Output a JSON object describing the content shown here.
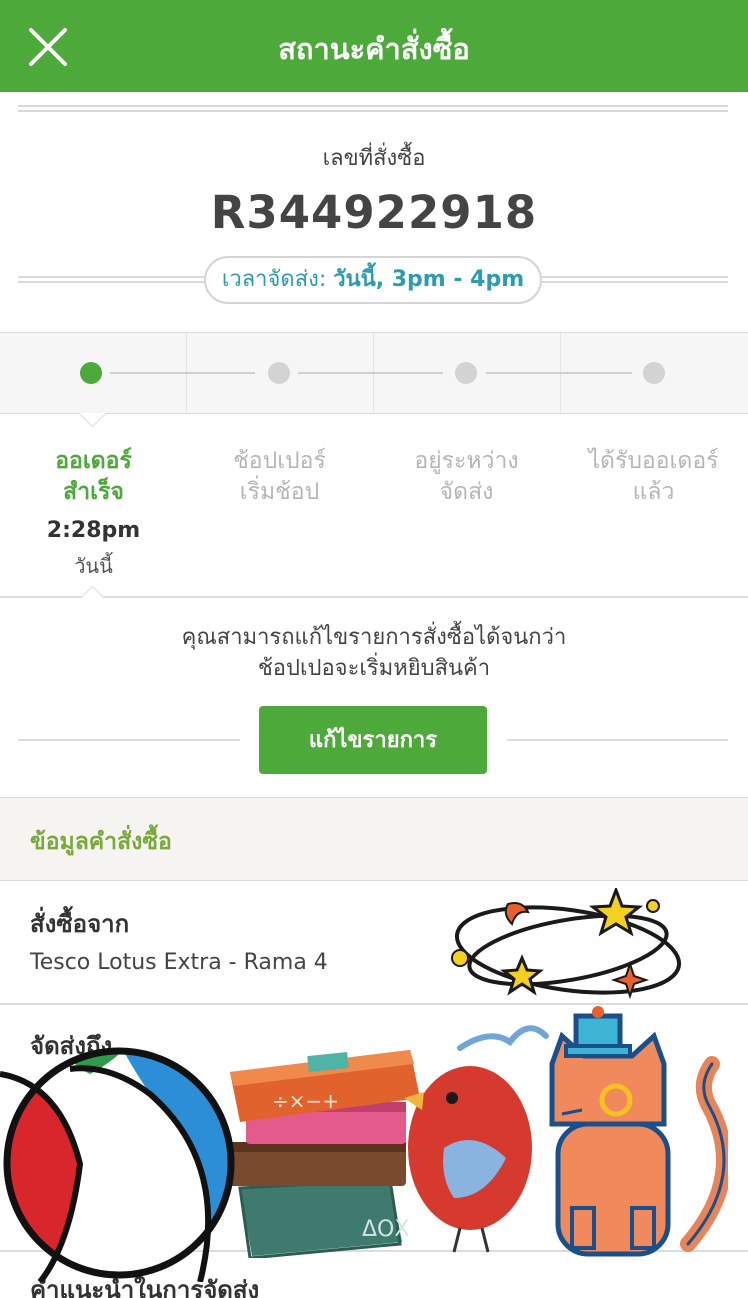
{
  "header": {
    "title": "สถานะคำสั่งซื้อ",
    "close_icon": "close-icon"
  },
  "order": {
    "number_label": "เลขที่สั่งซื้อ",
    "number": "R344922918",
    "delivery_label": "เวลาจัดส่ง:",
    "delivery_value": "วันนี้, 3pm - 4pm"
  },
  "progress": {
    "steps": [
      {
        "line1": "ออเดอร์",
        "line2": "สำเร็จ",
        "time": "2:28pm",
        "day": "วันนี้",
        "active": true
      },
      {
        "line1": "ช้อปเปอร์",
        "line2": "เริ่มช้อป",
        "active": false
      },
      {
        "line1": "อยู่ระหว่าง",
        "line2": "จัดส่ง",
        "active": false
      },
      {
        "line1": "ได้รับออเดอร์",
        "line2": "แล้ว",
        "active": false
      }
    ]
  },
  "edit": {
    "note_line1": "คุณสามารถแก้ไขรายการสั่งซื้อได้จนกว่า",
    "note_line2": "ช้อปเปอจะเริ่มหยิบสินค้า",
    "button_label": "แก้ไขรายการ"
  },
  "info": {
    "section_title": "ข้อมูลคำสั่งซื้อ",
    "ordered_from_label": "สั่งซื้อจาก",
    "ordered_from_value": "Tesco Lotus Extra - Rama 4",
    "deliver_to_label": "จัดส่งถึง",
    "delivery_instructions_label": "คำแนะนำในการจัดส่ง"
  },
  "colors": {
    "brand_green": "#4ca93a",
    "delivery_teal": "#2d9bb0",
    "section_green": "#7aa83c"
  },
  "stickers": [
    "dizzy-stars-sticker",
    "beach-ball-sticker",
    "books-sticker",
    "red-bird-sticker",
    "orange-cat-sticker"
  ]
}
